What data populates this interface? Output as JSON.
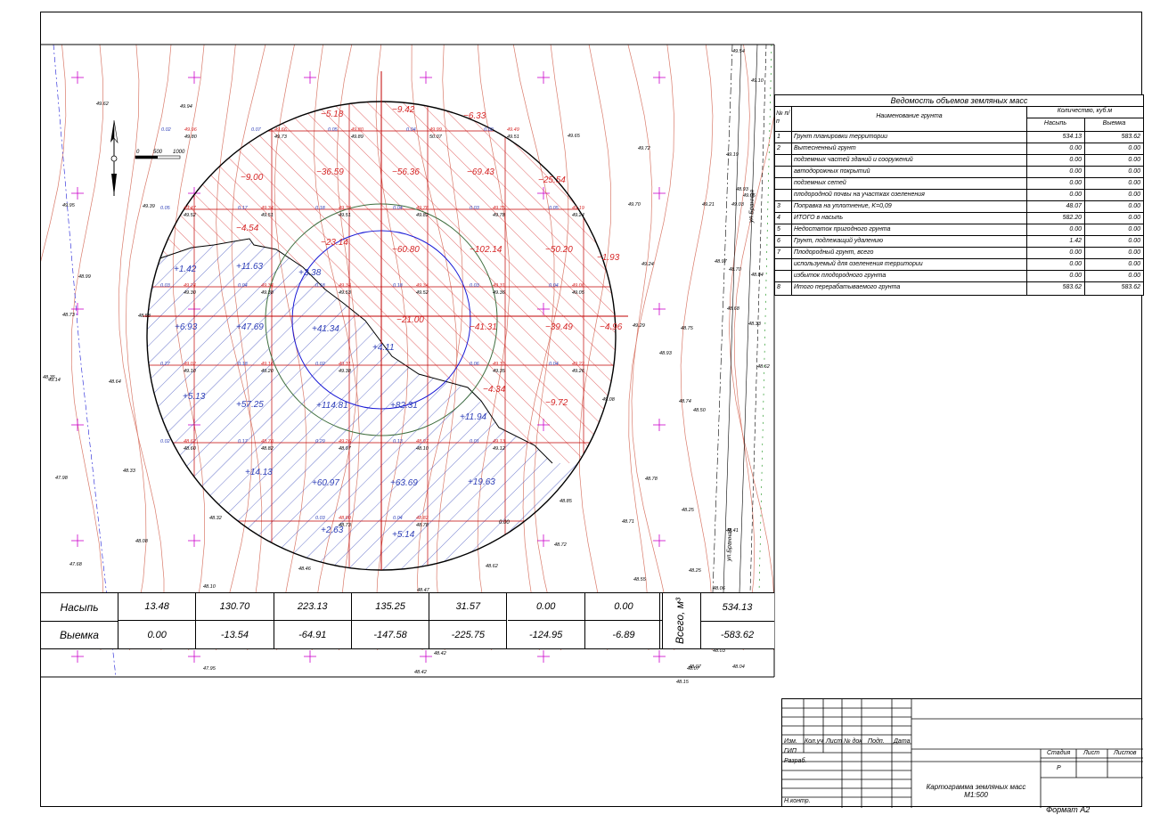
{
  "drawing": {
    "scale_bar": {
      "t0": "0",
      "t1": "500",
      "t2": "1000"
    },
    "top_right_number": "0.00",
    "colors": {
      "fill": "#d62828",
      "cut": "#2e3fb8",
      "grid": "#c00000",
      "contour": "#d97a6a",
      "circle_inner": "#1a1ad6",
      "circle_outer": "#3e6e3e",
      "marker": "#cc00cc"
    },
    "cells": [
      {
        "v": "5.18",
        "c": "r"
      },
      {
        "v": "9.42",
        "c": "r"
      },
      {
        "v": "6.33",
        "c": "r"
      },
      {
        "v": "9.00",
        "c": "r"
      },
      {
        "v": "36.59",
        "c": "r"
      },
      {
        "v": "56.36",
        "c": "r"
      },
      {
        "v": "69.43",
        "c": "r"
      },
      {
        "v": "25.54",
        "c": "r"
      },
      {
        "v": "4.54",
        "c": "r"
      },
      {
        "v": "23.14",
        "c": "r"
      },
      {
        "v": "60.80",
        "c": "r"
      },
      {
        "v": "102.14",
        "c": "r"
      },
      {
        "v": "50.20",
        "c": "r"
      },
      {
        "v": "1.93",
        "c": "r"
      },
      {
        "v": "1.42",
        "c": "b"
      },
      {
        "v": "11.63",
        "c": "b"
      },
      {
        "v": "3.38",
        "c": "b"
      },
      {
        "v": "21.00",
        "c": "r"
      },
      {
        "v": "41.31",
        "c": "r"
      },
      {
        "v": "39.49",
        "c": "r"
      },
      {
        "v": "4.96",
        "c": "r"
      },
      {
        "v": "6.93",
        "c": "b"
      },
      {
        "v": "47.69",
        "c": "b"
      },
      {
        "v": "41.34",
        "c": "b"
      },
      {
        "v": "4.11",
        "c": "b"
      },
      {
        "v": "4.34",
        "c": "r"
      },
      {
        "v": "9.72",
        "c": "r"
      },
      {
        "v": "5.13",
        "c": "b"
      },
      {
        "v": "57.25",
        "c": "b"
      },
      {
        "v": "114.81",
        "c": "b"
      },
      {
        "v": "82.31",
        "c": "b"
      },
      {
        "v": "11.94",
        "c": "b"
      },
      {
        "v": "14.13",
        "c": "b"
      },
      {
        "v": "60.97",
        "c": "b"
      },
      {
        "v": "63.69",
        "c": "b"
      },
      {
        "v": "19.63",
        "c": "b"
      },
      {
        "v": "2.63",
        "c": "b"
      },
      {
        "v": "5.14",
        "c": "b"
      }
    ],
    "node_labels": [
      "0.02",
      "49.96",
      "49.80",
      "0.07",
      "49.66",
      "49.73",
      "0.05",
      "49.80",
      "49.89",
      "0.04",
      "49.99",
      "50.07",
      "0.02",
      "49.49",
      "49.51",
      "0.05",
      "49.47",
      "49.52",
      "0.17",
      "49.34",
      "49.51",
      "0.18",
      "49.33",
      "49.51",
      "0.04",
      "49.78",
      "49.82",
      "0.03",
      "49.75",
      "49.78",
      "0.05",
      "49.19",
      "49.24",
      "0.03",
      "49.24",
      "49.30",
      "0.04",
      "49.34",
      "49.38",
      "0.18",
      "49.34",
      "49.53",
      "0.18",
      "49.34",
      "49.52",
      "0.03",
      "49.31",
      "49.36",
      "0.04",
      "49.06",
      "49.05",
      "0.27",
      "49.02",
      "49.10",
      "0.18",
      "49.16",
      "49.20",
      "0.02",
      "49.31",
      "49.38",
      "0.06",
      "49.31",
      "49.35",
      "0.04",
      "49.22",
      "49.26",
      "0.02",
      "48.62",
      "48.60",
      "0.17",
      "48.70",
      "48.82",
      "0.29",
      "49.26",
      "48.97",
      "0.13",
      "48.97",
      "48.10",
      "0.01",
      "49.13",
      "49.12",
      "0.03",
      "48.80",
      "48.73",
      "0.04",
      "48.82",
      "48.78"
    ],
    "elevations": [
      "49.62",
      "49.94",
      "49.95",
      "49.39",
      "48.99",
      "48.73",
      "48.58",
      "48.64",
      "48.35",
      "47.98",
      "48.33",
      "48.32",
      "48.08",
      "47.68",
      "48.46",
      "48.10",
      "48.47",
      "48.62",
      "48.85",
      "48.72",
      "49.65",
      "49.72",
      "49.70",
      "49.29",
      "49.08",
      "48.93",
      "48.74",
      "48.50",
      "48.78",
      "48.71",
      "48.25",
      "48.55",
      "48.25",
      "49.05",
      "49.54",
      "49.10",
      "49.19",
      "48.93",
      "49.03",
      "49.21",
      "48.97",
      "48.70",
      "48.84",
      "48.68",
      "48.75",
      "48.62",
      "48.41",
      "48.07",
      "48.06",
      "49.14",
      "48.42",
      "48.42",
      "48.03",
      "48.07",
      "48.15",
      "48.04",
      "49.24",
      "47.95",
      "48.33"
    ],
    "street": "ул.Бранная"
  },
  "summary": {
    "row1_label": "Насыпь",
    "row2_label": "Выемка",
    "fill": [
      "13.48",
      "130.70",
      "223.13",
      "135.25",
      "31.57",
      "0.00",
      "0.00"
    ],
    "cut": [
      "0.00",
      "-13.54",
      "-64.91",
      "-147.58",
      "-225.75",
      "-124.95",
      "-6.89"
    ],
    "total_label": "Всего, м³",
    "total_fill": "534.13",
    "total_cut": "-583.62"
  },
  "volume_table": {
    "title": "Ведомость объемов земляных масс",
    "col_num": "№ п/п",
    "col_name": "Наименование грунта",
    "col_qty": "Количество, куб.м",
    "col_fill": "Насыпь",
    "col_cut": "Выемка",
    "rows": [
      {
        "n": "1",
        "name": "Грунт планировки территории",
        "fill": "534.13",
        "cut": "583.62"
      },
      {
        "n": "2",
        "name": "Вытесненный грунт",
        "fill": "0.00",
        "cut": "0.00"
      },
      {
        "n": "",
        "name": "подземных частей зданий и сооружений",
        "fill": "0.00",
        "cut": "0.00"
      },
      {
        "n": "",
        "name": "автодорожных покрытий",
        "fill": "0.00",
        "cut": "0.00"
      },
      {
        "n": "",
        "name": "подземных сетей",
        "fill": "0.00",
        "cut": "0.00"
      },
      {
        "n": "",
        "name": "плодородной почвы на участках озеленения",
        "fill": "0.00",
        "cut": "0.00"
      },
      {
        "n": "3",
        "name": "Поправка на уплотнение, K=0,09",
        "fill": "48.07",
        "cut": "0.00"
      },
      {
        "n": "4",
        "name": "ИТОГО в насыпь",
        "fill": "582.20",
        "cut": "0.00"
      },
      {
        "n": "5",
        "name": "Недостаток пригодного грунта",
        "fill": "0.00",
        "cut": "0.00"
      },
      {
        "n": "6",
        "name": "Грунт, подлежащий удалению",
        "fill": "1.42",
        "cut": "0.00"
      },
      {
        "n": "7",
        "name": "Плодородный грунт, всего",
        "fill": "0.00",
        "cut": "0.00"
      },
      {
        "n": "",
        "name": "используемый для озеленения территории",
        "fill": "0.00",
        "cut": "0.00"
      },
      {
        "n": "",
        "name": "избыток плодородного грунта",
        "fill": "0.00",
        "cut": "0.00"
      },
      {
        "n": "8",
        "name": "Итого перерабатываемого грунта",
        "fill": "583.62",
        "cut": "583.62"
      }
    ]
  },
  "stamp": {
    "h_izm": "Изм.",
    "h_koluch": "Кол.уч",
    "h_list": "Лист",
    "h_ndok": "№ док",
    "h_podp": "Подп.",
    "h_data": "Дата",
    "gip": "ГИП",
    "razrab": "Разраб.",
    "nkontr": "Н.контр.",
    "stadia": "Стадия",
    "list": "Лист",
    "listov": "Листов",
    "stadia_val": "Р",
    "title": "Картограмма земляных масс",
    "scale": "М1:500",
    "format": "Формат А2"
  }
}
